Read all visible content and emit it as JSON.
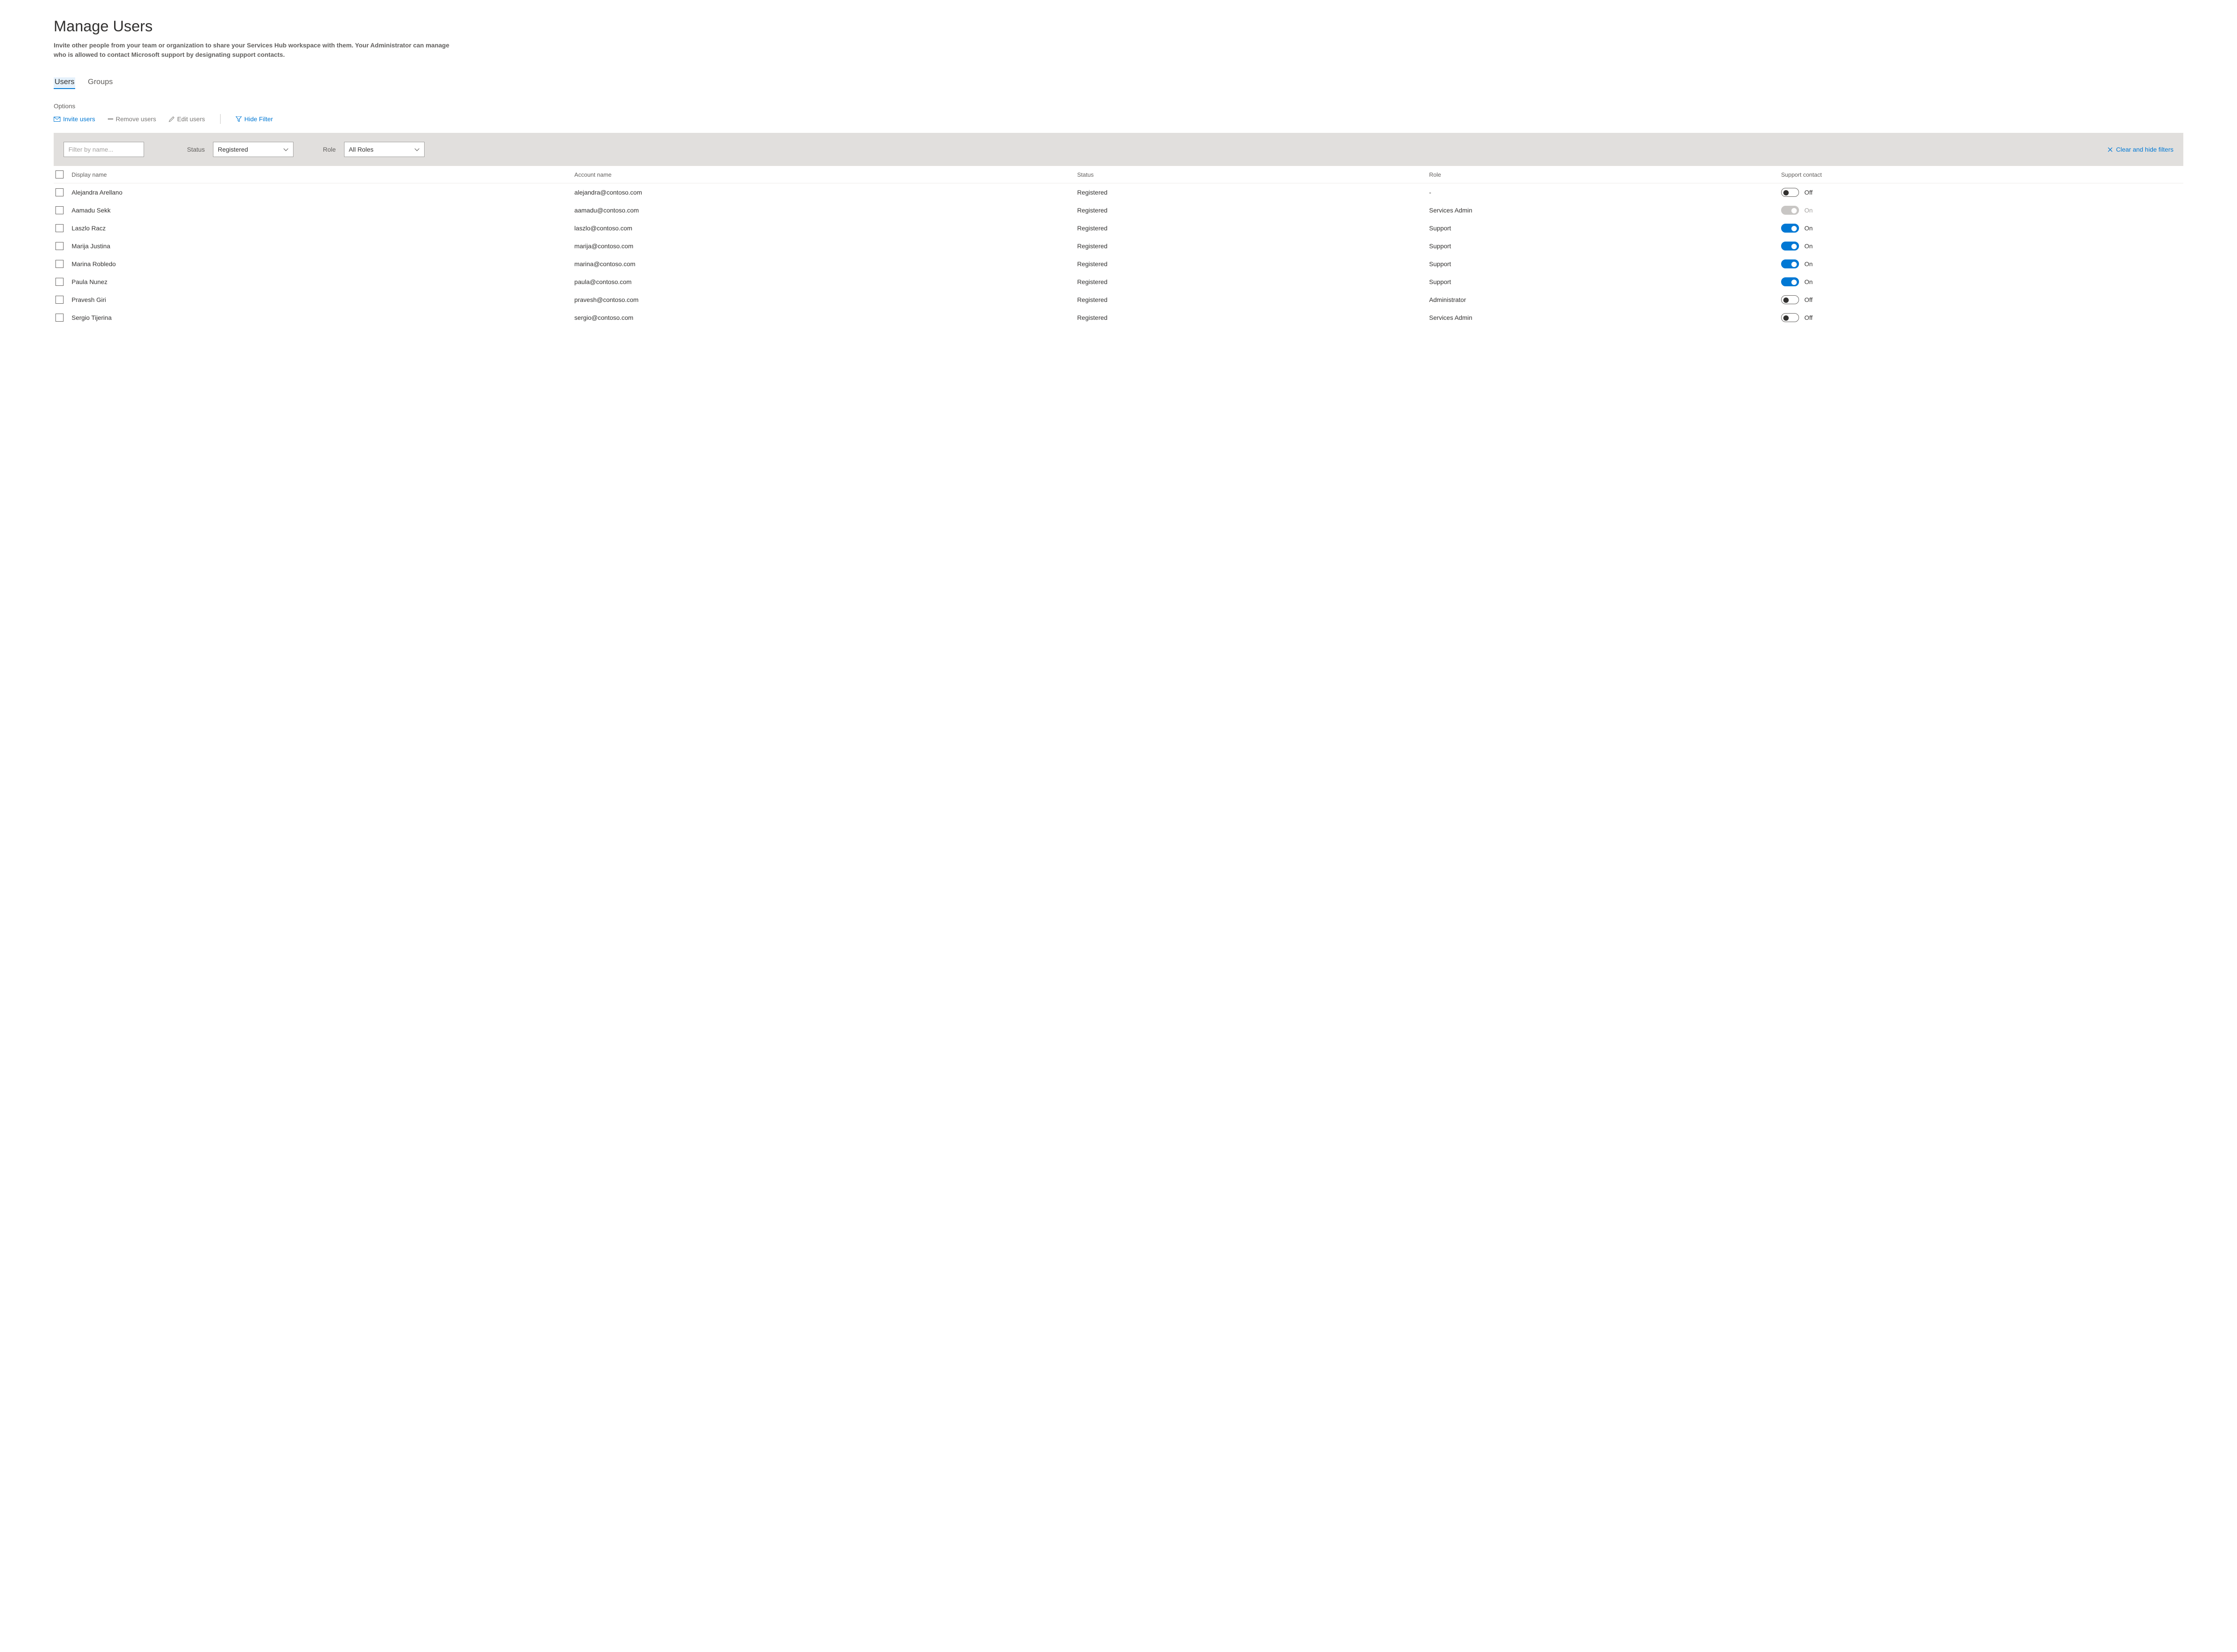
{
  "page": {
    "title": "Manage Users",
    "description": "Invite other people from your team or organization to share your Services Hub workspace with them. Your Administrator can manage who is allowed to contact Microsoft support by designating support contacts."
  },
  "tabs": [
    {
      "label": "Users",
      "active": true
    },
    {
      "label": "Groups",
      "active": false
    }
  ],
  "options_label": "Options",
  "toolbar": {
    "invite": "Invite users",
    "remove": "Remove users",
    "edit": "Edit users",
    "hide_filter": "Hide Filter"
  },
  "filters": {
    "name_placeholder": "Filter by name...",
    "status_label": "Status",
    "status_value": "Registered",
    "role_label": "Role",
    "role_value": "All Roles",
    "clear_label": "Clear and hide filters"
  },
  "columns": {
    "display_name": "Display name",
    "account_name": "Account name",
    "status": "Status",
    "role": "Role",
    "support_contact": "Support contact"
  },
  "rows": [
    {
      "display_name": "Alejandra Arellano",
      "account_name": "alejandra@contoso.com",
      "status": "Registered",
      "role": "-",
      "support_on": false,
      "support_label": "Off",
      "disabled": false
    },
    {
      "display_name": "Aamadu Sekk",
      "account_name": "aamadu@contoso.com",
      "status": "Registered",
      "role": "Services Admin",
      "support_on": true,
      "support_label": "On",
      "disabled": true
    },
    {
      "display_name": "Laszlo Racz",
      "account_name": "laszlo@contoso.com",
      "status": "Registered",
      "role": "Support",
      "support_on": true,
      "support_label": "On",
      "disabled": false
    },
    {
      "display_name": "Marija Justina",
      "account_name": "marija@contoso.com",
      "status": "Registered",
      "role": "Support",
      "support_on": true,
      "support_label": "On",
      "disabled": false
    },
    {
      "display_name": "Marina Robledo",
      "account_name": "marina@contoso.com",
      "status": "Registered",
      "role": "Support",
      "support_on": true,
      "support_label": "On",
      "disabled": false
    },
    {
      "display_name": "Paula Nunez",
      "account_name": "paula@contoso.com",
      "status": "Registered",
      "role": "Support",
      "support_on": true,
      "support_label": "On",
      "disabled": false
    },
    {
      "display_name": "Pravesh Giri",
      "account_name": "pravesh@contoso.com",
      "status": "Registered",
      "role": "Administrator",
      "support_on": false,
      "support_label": "Off",
      "disabled": false
    },
    {
      "display_name": "Sergio Tijerina",
      "account_name": "sergio@contoso.com",
      "status": "Registered",
      "role": "Services Admin",
      "support_on": false,
      "support_label": "Off",
      "disabled": false
    }
  ]
}
